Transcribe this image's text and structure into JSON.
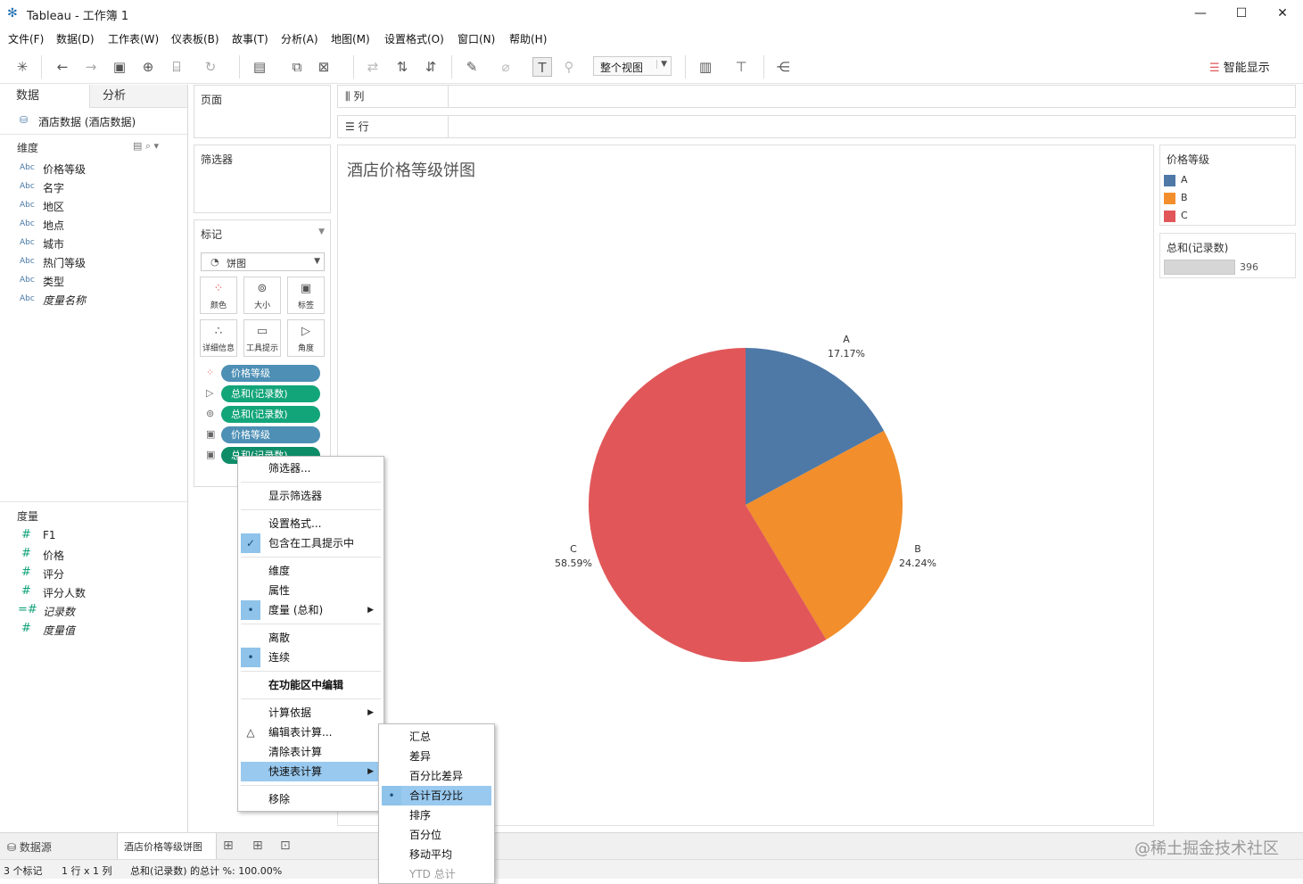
{
  "window": {
    "title": "Tableau - 工作簿 1",
    "controls": [
      "—",
      "☐",
      "✕"
    ]
  },
  "menu": [
    "文件(F)",
    "数据(D)",
    "工作表(W)",
    "仪表板(B)",
    "故事(T)",
    "分析(A)",
    "地图(M)",
    "设置格式(O)",
    "窗口(N)",
    "帮助(H)"
  ],
  "toolbar": {
    "view_select": "整个视图",
    "smart_show": "智能显示"
  },
  "left": {
    "tab_data": "数据",
    "tab_analysis": "分析",
    "datasource": "酒店数据 (酒店数据)",
    "dimensions_header": "维度",
    "dimensions": [
      {
        "type": "Abc",
        "name": "价格等级"
      },
      {
        "type": "Abc",
        "name": "名字"
      },
      {
        "type": "Abc",
        "name": "地区"
      },
      {
        "type": "Abc",
        "name": "地点"
      },
      {
        "type": "Abc",
        "name": "城市"
      },
      {
        "type": "Abc",
        "name": "热门等级"
      },
      {
        "type": "Abc",
        "name": "类型"
      },
      {
        "type": "Abc",
        "name": "度量名称"
      }
    ],
    "measures_header": "度量",
    "measures": [
      {
        "type": "#",
        "name": "F1"
      },
      {
        "type": "#",
        "name": "价格"
      },
      {
        "type": "#",
        "name": "评分"
      },
      {
        "type": "#",
        "name": "评分人数"
      },
      {
        "type": "=#",
        "name": "记录数"
      },
      {
        "type": "#",
        "name": "度量值"
      }
    ]
  },
  "cards": {
    "pages": "页面",
    "filters": "筛选器",
    "marks": "标记",
    "mark_type": "饼图",
    "mark_buttons": [
      {
        "icon": "color",
        "label": "颜色"
      },
      {
        "icon": "size",
        "label": "大小"
      },
      {
        "icon": "label",
        "label": "标签"
      },
      {
        "icon": "detail",
        "label": "详细信息"
      },
      {
        "icon": "tooltip",
        "label": "工具提示"
      },
      {
        "icon": "angle",
        "label": "角度"
      }
    ],
    "pills": [
      {
        "icon": "color",
        "text": "价格等级",
        "color": "blue"
      },
      {
        "icon": "angle",
        "text": "总和(记录数)",
        "color": "green"
      },
      {
        "icon": "size",
        "text": "总和(记录数)",
        "color": "green"
      },
      {
        "icon": "label",
        "text": "价格等级",
        "color": "blue"
      },
      {
        "icon": "label",
        "text": "总和(记录数)",
        "color": "green"
      }
    ]
  },
  "shelves": {
    "columns": "列",
    "rows": "行"
  },
  "view": {
    "title": "酒店价格等级饼图"
  },
  "chart_data": {
    "type": "pie",
    "categories": [
      "A",
      "B",
      "C"
    ],
    "values": [
      17.17,
      24.24,
      58.59
    ],
    "labels": [
      "17.17%",
      "24.24%",
      "58.59%"
    ],
    "colors": [
      "#4e79a7",
      "#f28e2b",
      "#e15759"
    ]
  },
  "legend": {
    "title": "价格等级",
    "items": [
      {
        "label": "A",
        "color": "#4e79a7"
      },
      {
        "label": "B",
        "color": "#f28e2b"
      },
      {
        "label": "C",
        "color": "#e15759"
      }
    ],
    "size_title": "总和(记录数)",
    "size_value": "396"
  },
  "context_menu": {
    "items": [
      {
        "text": "筛选器...",
        "check": ""
      },
      {
        "sep": true
      },
      {
        "text": "显示筛选器",
        "check": ""
      },
      {
        "sep": true
      },
      {
        "text": "设置格式...",
        "check": ""
      },
      {
        "text": "包含在工具提示中",
        "check": "✓"
      },
      {
        "sep": true
      },
      {
        "text": "维度",
        "check": ""
      },
      {
        "text": "属性",
        "check": ""
      },
      {
        "text": "度量 (总和)",
        "check": "•",
        "submenu": true
      },
      {
        "sep": true
      },
      {
        "text": "离散",
        "check": ""
      },
      {
        "text": "连续",
        "check": "•"
      },
      {
        "sep": true
      },
      {
        "text": "在功能区中编辑",
        "check": "",
        "bold": true
      },
      {
        "sep": true
      },
      {
        "text": "计算依据",
        "check": "",
        "submenu": true
      },
      {
        "text": "编辑表计算...",
        "check": "△"
      },
      {
        "text": "清除表计算",
        "check": ""
      },
      {
        "text": "快速表计算",
        "check": "",
        "submenu": true,
        "highlight": true
      },
      {
        "sep": true
      },
      {
        "text": "移除",
        "check": ""
      }
    ],
    "submenu": [
      {
        "text": "汇总",
        "check": ""
      },
      {
        "text": "差异",
        "check": ""
      },
      {
        "text": "百分比差异",
        "check": ""
      },
      {
        "text": "合计百分比",
        "check": "•",
        "highlight": true
      },
      {
        "text": "排序",
        "check": ""
      },
      {
        "text": "百分位",
        "check": ""
      },
      {
        "text": "移动平均",
        "check": ""
      },
      {
        "text": "YTD 总计",
        "check": "",
        "dim": true
      }
    ]
  },
  "sheetbar": {
    "datasource_tab": "数据源",
    "sheet_tab": "酒店价格等级饼图"
  },
  "status": {
    "marks": "3 个标记",
    "rowscols": "1 行 x 1 列",
    "summary": "总和(记录数) 的总计 %: 100.00%"
  },
  "watermark": "@稀土掘金技术社区"
}
